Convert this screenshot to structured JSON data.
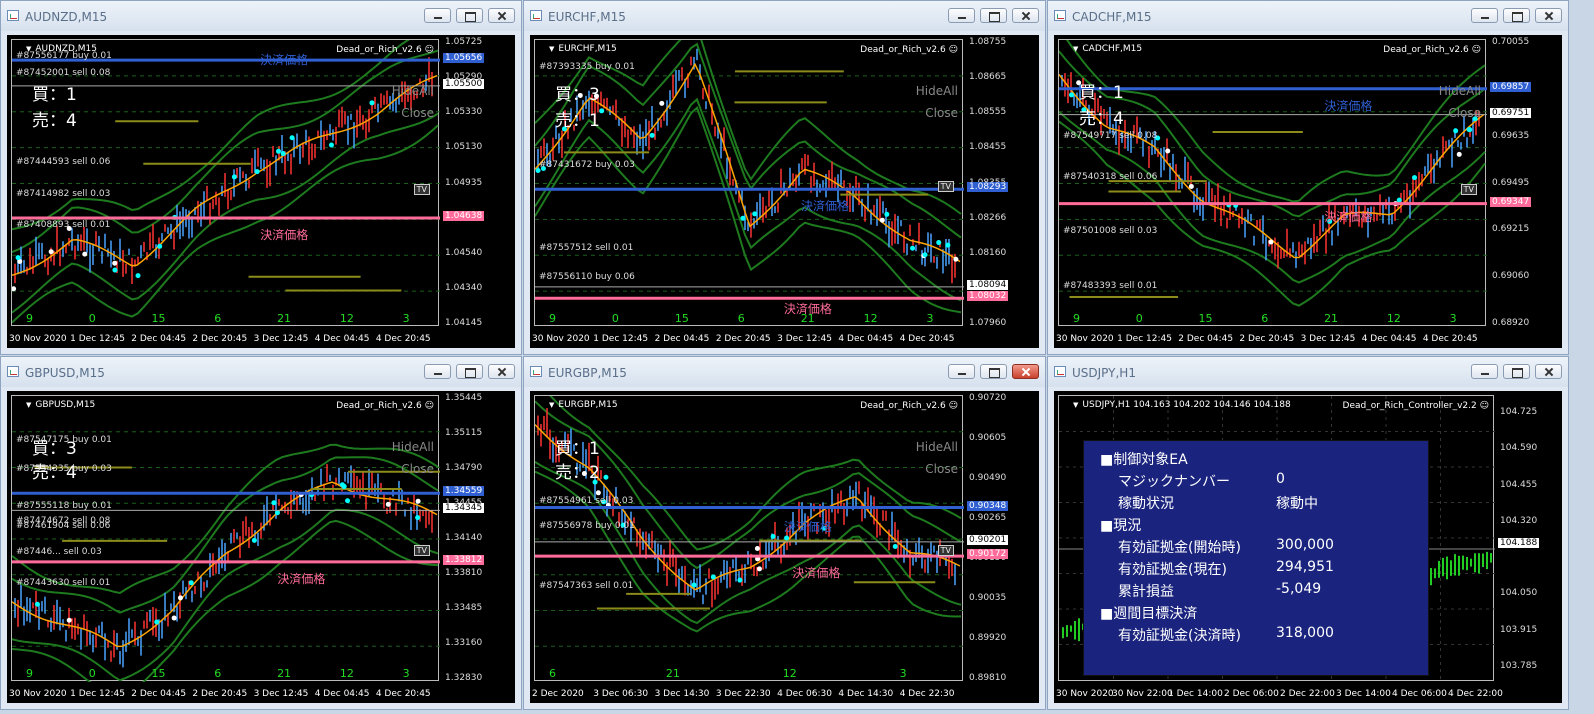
{
  "windows": [
    {
      "id": "audnzd",
      "title": "AUDNZD,M15",
      "symbol_label": "AUDNZD,M15",
      "ea_label": "Dead_or_Rich_v2.6",
      "buy_label": "買：1",
      "sell_label": "売：4",
      "hide_all": "HideAll",
      "close_label": "Close",
      "price_labels": [
        "1.05725",
        "1.05290",
        "1.05330",
        "1.05130",
        "1.04935",
        "1.04740",
        "1.04540",
        "1.04340",
        "1.04145"
      ],
      "tags": [
        {
          "text": "1.05656",
          "color": "#2f5fd1"
        },
        {
          "text": "1.05500",
          "color": "#ffffff"
        },
        {
          "text": "1.04638",
          "color": "#ff6b9a"
        }
      ],
      "time_labels": [
        "30 Nov 2020",
        "1 Dec 12:45",
        "2 Dec 04:45",
        "2 Dec 20:45",
        "3 Dec 12:45",
        "4 Dec 04:45",
        "4 Dec 20:45"
      ],
      "day_nums": [
        "9",
        "0",
        "15",
        "6",
        "21",
        "12",
        "3"
      ],
      "orders": [
        "#87556177 buy 0.01",
        "#87452001 sell 0.08",
        "#87444593 sell 0.06",
        "#87414982 sell 0.03",
        "#87408893 sell 0.01"
      ],
      "settle_label": "決済価格",
      "tv": "TV"
    },
    {
      "id": "eurchf",
      "title": "EURCHF,M15",
      "symbol_label": "EURCHF,M15",
      "ea_label": "Dead_or_Rich_v2.6",
      "buy_label": "買：3",
      "sell_label": "売：1",
      "hide_all": "HideAll",
      "close_label": "Close",
      "price_labels": [
        "1.08755",
        "1.08665",
        "1.08555",
        "1.08455",
        "1.08355",
        "1.08266",
        "1.08160",
        "1.08066",
        "1.07960"
      ],
      "tags": [
        {
          "text": "1.08293",
          "color": "#2f5fd1"
        },
        {
          "text": "1.08094",
          "color": "#ffffff"
        },
        {
          "text": "1.08032",
          "color": "#ff6b9a"
        }
      ],
      "time_labels": [
        "30 Nov 2020",
        "1 Dec 12:45",
        "2 Dec 04:45",
        "2 Dec 20:45",
        "3 Dec 12:45",
        "4 Dec 04:45",
        "4 Dec 20:45"
      ],
      "day_nums": [
        "9",
        "0",
        "15",
        "6",
        "21",
        "12",
        "3"
      ],
      "orders": [
        "#87393335 buy 0.01",
        "#87431672 buy 0.03",
        "#87557512 sell 0.01",
        "#87556110 buy 0.06"
      ],
      "settle_label": "決済価格",
      "tv": "TV"
    },
    {
      "id": "cadchf",
      "title": "CADCHF,M15",
      "symbol_label": "CADCHF,M15",
      "ea_label": "Dead_or_Rich_v2.6",
      "buy_label": "買：1",
      "sell_label": "売：4",
      "hide_all": "HideAll",
      "close_label": "Close",
      "price_labels": [
        "0.70055",
        "0.69915",
        "0.69635",
        "0.69495",
        "0.69215",
        "0.69060",
        "0.68920"
      ],
      "tags": [
        {
          "text": "0.69857",
          "color": "#2f5fd1"
        },
        {
          "text": "0.69751",
          "color": "#ffffff"
        },
        {
          "text": "0.69347",
          "color": "#ff6b9a"
        }
      ],
      "time_labels": [
        "30 Nov 2020",
        "1 Dec 12:45",
        "2 Dec 04:45",
        "2 Dec 20:45",
        "3 Dec 12:45",
        "4 Dec 04:45",
        "4 Dec 20:45"
      ],
      "day_nums": [
        "9",
        "0",
        "15",
        "6",
        "21",
        "12",
        "3"
      ],
      "orders": [
        "#87549717 sell 0.08",
        "#87540318 sell 0.06",
        "#87501008 sell 0.03",
        "#87483393 sell 0.01"
      ],
      "settle_label": "決済価格",
      "tv": "TV"
    },
    {
      "id": "gbpusd",
      "title": "GBPUSD,M15",
      "symbol_label": "GBPUSD,M15",
      "ea_label": "Dead_or_Rich_v2.6",
      "buy_label": "買：3",
      "sell_label": "売：4",
      "hide_all": "HideAll",
      "close_label": "Close",
      "price_labels": [
        "1.35445",
        "1.35115",
        "1.34790",
        "1.34455",
        "1.34140",
        "1.33810",
        "1.33485",
        "1.33160",
        "1.32830"
      ],
      "tags": [
        {
          "text": "1.34559",
          "color": "#2f5fd1"
        },
        {
          "text": "1.34345",
          "color": "#ffffff"
        },
        {
          "text": "1.33812",
          "color": "#ff6b9a"
        }
      ],
      "time_labels": [
        "30 Nov 2020",
        "1 Dec 12:45",
        "2 Dec 04:45",
        "2 Dec 20:45",
        "3 Dec 12:45",
        "4 Dec 04:45",
        "4 Dec 20:45"
      ],
      "day_nums": [
        "9",
        "0",
        "15",
        "6",
        "21",
        "12",
        "3"
      ],
      "orders": [
        "#87547175 buy 0.01",
        "#87554335 buy 0.03",
        "#87555118 buy 0.01",
        "#87474672 sell 0.08",
        "#87461904 sell 0.06",
        "#87446... sell 0.03",
        "#87443630 sell 0.01"
      ],
      "settle_label": "決済価格",
      "tv": "TV"
    },
    {
      "id": "eurgbp",
      "title": "EURGBP,M15",
      "symbol_label": "EURGBP,M15",
      "ea_label": "Dead_or_Rich_v2.6",
      "buy_label": "買：1",
      "sell_label": "売：2",
      "hide_all": "HideAll",
      "close_label": "Close",
      "price_labels": [
        "0.90720",
        "0.90605",
        "0.90490",
        "0.90265",
        "0.90150",
        "0.90035",
        "0.89920",
        "0.89810"
      ],
      "tags": [
        {
          "text": "0.90348",
          "color": "#2f5fd1"
        },
        {
          "text": "0.90201",
          "color": "#ffffff"
        },
        {
          "text": "0.90172",
          "color": "#ff6b9a"
        }
      ],
      "time_labels": [
        "2 Dec 2020",
        "3 Dec 06:30",
        "3 Dec 14:30",
        "3 Dec 22:30",
        "4 Dec 06:30",
        "4 Dec 14:30",
        "4 Dec 22:30"
      ],
      "day_nums": [
        "6",
        "21",
        "12",
        "3"
      ],
      "orders": [
        "#87554961 sell 0.03",
        "#87556978 buy 0.01",
        "#87547363 sell 0.01"
      ],
      "settle_label": "決済価格",
      "tv": "TV"
    }
  ],
  "usdjpy": {
    "title": "USDJPY,H1",
    "symbol_label": "USDJPY,H1 104.163 104.202 104.146 104.188",
    "ea_label": "Dead_or_Rich_Controller_v2.2",
    "price_labels": [
      "104.725",
      "104.590",
      "104.455",
      "104.320",
      "104.188",
      "104.050",
      "103.915",
      "103.785"
    ],
    "current_tag": "104.188",
    "time_labels": [
      "30 Nov 2020",
      "30 Nov 22:00",
      "1 Dec 14:00",
      "2 Dec 06:00",
      "2 Dec 22:00",
      "3 Dec 14:00",
      "4 Dec 06:00",
      "4 Dec 22:00"
    ],
    "panel": {
      "sec1": "■制御対象EA",
      "magic_label": "マジックナンバー",
      "magic_value": "0",
      "status_label": "稼動状況",
      "status_value": "稼動中",
      "sec2": "■現況",
      "eq_start_label": "有効証拠金(開始時)",
      "eq_start_value": "300,000",
      "eq_now_label": "有効証拠金(現在)",
      "eq_now_value": "294,951",
      "pnl_label": "累計損益",
      "pnl_value": "-5,049",
      "sec3": "■週間目標決済",
      "eq_target_label": "有効証拠金(決済時)",
      "eq_target_value": "318,000"
    }
  },
  "colors": {
    "blue_line": "#2f5fd1",
    "pink_line": "#ff6b9a",
    "green_band": "#1e7a1e",
    "ma": "#ffa500",
    "up": "#4aa3ff",
    "down": "#ff3333"
  }
}
